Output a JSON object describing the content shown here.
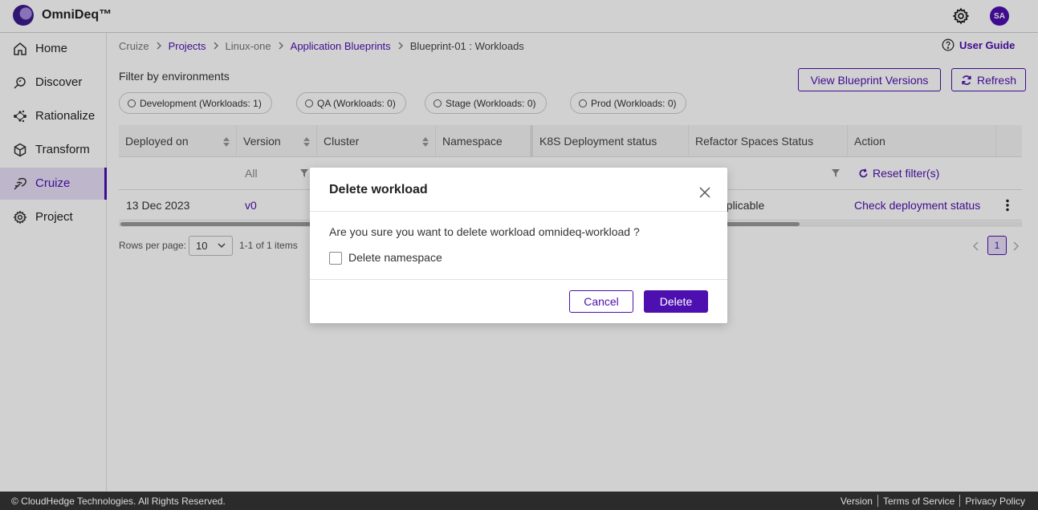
{
  "header": {
    "brand": "OmniDeq™",
    "avatar_initials": "SA",
    "settings_icon": "gear-icon"
  },
  "sidebar": {
    "items": [
      {
        "label": "Home",
        "icon": "home-icon"
      },
      {
        "label": "Discover",
        "icon": "discover-icon"
      },
      {
        "label": "Rationalize",
        "icon": "rationalize-icon"
      },
      {
        "label": "Transform",
        "icon": "cube-icon"
      },
      {
        "label": "Cruize",
        "icon": "cruize-icon",
        "active": true
      },
      {
        "label": "Project",
        "icon": "gear-icon"
      }
    ]
  },
  "breadcrumb": {
    "items": [
      "Cruize",
      "Projects",
      "Linux-one",
      "Application Blueprints",
      "Blueprint-01 : Workloads"
    ]
  },
  "user_guide": "User Guide",
  "filter": {
    "title": "Filter by environments",
    "chips": [
      "Development (Workloads: 1)",
      "QA (Workloads: 0)",
      "Stage (Workloads: 0)",
      "Prod (Workloads: 0)"
    ]
  },
  "actions": {
    "view_versions": "View Blueprint Versions",
    "refresh": "Refresh"
  },
  "table": {
    "columns": [
      "Deployed on",
      "Version",
      "Cluster",
      "Namespace",
      "K8S Deployment status",
      "Refactor Spaces Status",
      "Action"
    ],
    "version_filter": "All",
    "reset_filter": "Reset filter(s)",
    "row": {
      "deployed_on": "13 Dec 2023",
      "version": "v0",
      "refactor_status_partial": "pplicable",
      "action": "Check deployment status"
    }
  },
  "pagination": {
    "rows_label": "Rows per page:",
    "rows_value": "10",
    "items_count": "1-1 of 1 items",
    "current_page": "1"
  },
  "footer": {
    "copyright": "© CloudHedge Technologies. All Rights Reserved.",
    "links": [
      "Version",
      "Terms of Service",
      "Privacy Policy"
    ]
  },
  "modal": {
    "title": "Delete workload",
    "message": "Are you sure you want to delete workload omnideq-workload ?",
    "checkbox_label": "Delete namespace",
    "cancel": "Cancel",
    "delete": "Delete"
  },
  "colors": {
    "accent": "#4d0fb0",
    "accent_light": "#e8e0f8",
    "footer_bg": "#2b2b2b"
  }
}
